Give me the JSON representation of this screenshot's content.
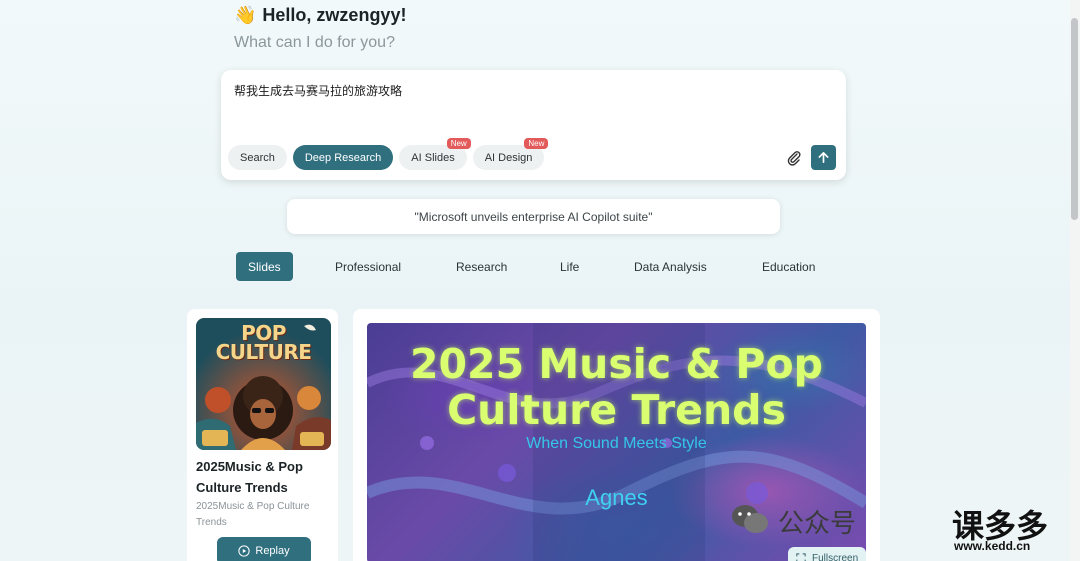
{
  "greeting": {
    "wave_emoji": "👋",
    "title": "Hello, zwzengyy!",
    "subtitle": "What can I do for you?"
  },
  "prompt": {
    "text": "帮我生成去马赛马拉的旅游攻略",
    "chips": [
      {
        "label": "Search",
        "active": false,
        "badge": ""
      },
      {
        "label": "Deep Research",
        "active": true,
        "badge": ""
      },
      {
        "label": "AI Slides",
        "active": false,
        "badge": "New"
      },
      {
        "label": "AI Design",
        "active": false,
        "badge": "New"
      }
    ]
  },
  "ticker": {
    "text": "\"Microsoft unveils enterprise AI Copilot suite\""
  },
  "categories": [
    "Slides",
    "Professional",
    "Research",
    "Life",
    "Data Analysis",
    "Education"
  ],
  "card": {
    "thumb_title": "POP CULTURE",
    "title": "2025Music & Pop Culture Trends",
    "subtitle": "2025Music & Pop Culture Trends",
    "replay_label": "Replay"
  },
  "preview": {
    "title": "2025 Music & Pop Culture Trends",
    "subtitle": "When Sound Meets Style",
    "author": "Agnes",
    "fullscreen_label": "Fullscreen"
  },
  "watermark": {
    "label": "公众号",
    "brand": "课多多",
    "url": "www.kedd.cn"
  },
  "colors": {
    "accent": "#2f6f7e",
    "badge": "#e25a5a",
    "slide_title": "#d9ff70",
    "slide_sub": "#35c6e8"
  }
}
